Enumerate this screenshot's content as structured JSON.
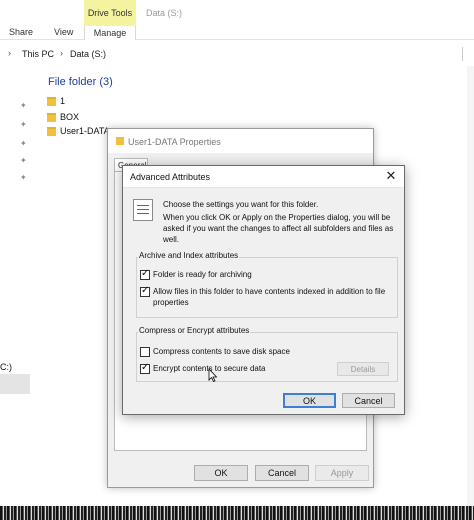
{
  "ribbon": {
    "tabs": [
      "Share",
      "View",
      "Manage"
    ],
    "context_tab": "Drive Tools",
    "window_title": "Data (S:)"
  },
  "address": {
    "crumbs": [
      "This PC",
      "Data (S:)"
    ],
    "separator": "›"
  },
  "content": {
    "group_header": "File folder (3)",
    "items": [
      "1",
      "BOX",
      "User1-DATA"
    ]
  },
  "left_pane": {
    "drive_label": "C:)"
  },
  "properties": {
    "title": "User1-DATA Properties",
    "tab_general": "General",
    "ok": "OK",
    "cancel": "Cancel",
    "apply": "Apply"
  },
  "advanced": {
    "title": "Advanced Attributes",
    "close": "✕",
    "desc1": "Choose the settings you want for this folder.",
    "desc2": "When you click OK or Apply on the Properties dialog, you will be asked if you want the changes to affect all subfolders and files as well.",
    "archive_group": "Archive and Index attributes",
    "archive_ready": "Folder is ready for archiving",
    "allow_index": "Allow files in this folder to have contents indexed in addition to file properties",
    "compress_group": "Compress or Encrypt attributes",
    "compress": "Compress contents to save disk space",
    "encrypt": "Encrypt contents to secure data",
    "details": "Details",
    "ok": "OK",
    "cancel": "Cancel",
    "checked": {
      "archive_ready": true,
      "allow_index": true,
      "compress": false,
      "encrypt": true
    }
  },
  "colors": {
    "context_tab_bg": "#f3f3a0",
    "group_header": "#1e3f99",
    "folder": "#f0c040",
    "default_button_border": "#3c7fd6"
  }
}
